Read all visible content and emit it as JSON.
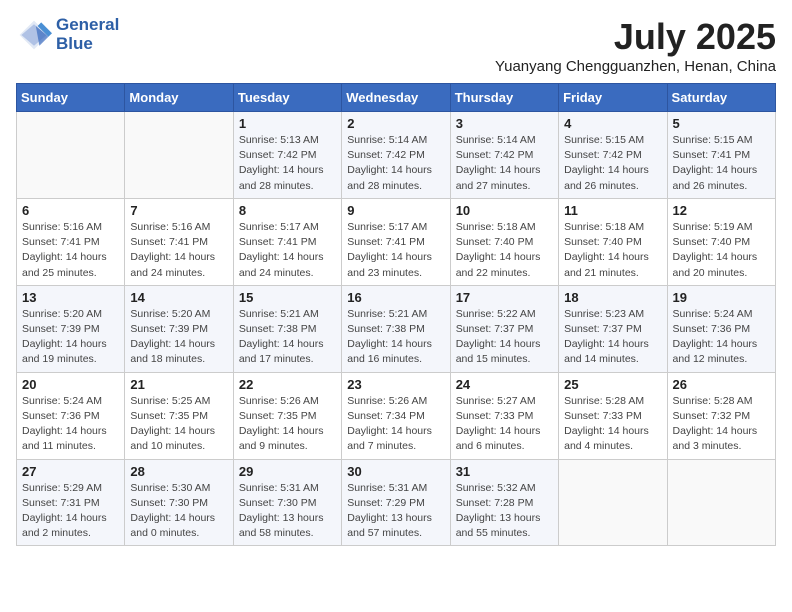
{
  "header": {
    "logo_line1": "General",
    "logo_line2": "Blue",
    "month_year": "July 2025",
    "location": "Yuanyang Chengguanzhen, Henan, China"
  },
  "weekdays": [
    "Sunday",
    "Monday",
    "Tuesday",
    "Wednesday",
    "Thursday",
    "Friday",
    "Saturday"
  ],
  "weeks": [
    [
      {
        "day": "",
        "info": ""
      },
      {
        "day": "",
        "info": ""
      },
      {
        "day": "1",
        "info": "Sunrise: 5:13 AM\nSunset: 7:42 PM\nDaylight: 14 hours\nand 28 minutes."
      },
      {
        "day": "2",
        "info": "Sunrise: 5:14 AM\nSunset: 7:42 PM\nDaylight: 14 hours\nand 28 minutes."
      },
      {
        "day": "3",
        "info": "Sunrise: 5:14 AM\nSunset: 7:42 PM\nDaylight: 14 hours\nand 27 minutes."
      },
      {
        "day": "4",
        "info": "Sunrise: 5:15 AM\nSunset: 7:42 PM\nDaylight: 14 hours\nand 26 minutes."
      },
      {
        "day": "5",
        "info": "Sunrise: 5:15 AM\nSunset: 7:41 PM\nDaylight: 14 hours\nand 26 minutes."
      }
    ],
    [
      {
        "day": "6",
        "info": "Sunrise: 5:16 AM\nSunset: 7:41 PM\nDaylight: 14 hours\nand 25 minutes."
      },
      {
        "day": "7",
        "info": "Sunrise: 5:16 AM\nSunset: 7:41 PM\nDaylight: 14 hours\nand 24 minutes."
      },
      {
        "day": "8",
        "info": "Sunrise: 5:17 AM\nSunset: 7:41 PM\nDaylight: 14 hours\nand 24 minutes."
      },
      {
        "day": "9",
        "info": "Sunrise: 5:17 AM\nSunset: 7:41 PM\nDaylight: 14 hours\nand 23 minutes."
      },
      {
        "day": "10",
        "info": "Sunrise: 5:18 AM\nSunset: 7:40 PM\nDaylight: 14 hours\nand 22 minutes."
      },
      {
        "day": "11",
        "info": "Sunrise: 5:18 AM\nSunset: 7:40 PM\nDaylight: 14 hours\nand 21 minutes."
      },
      {
        "day": "12",
        "info": "Sunrise: 5:19 AM\nSunset: 7:40 PM\nDaylight: 14 hours\nand 20 minutes."
      }
    ],
    [
      {
        "day": "13",
        "info": "Sunrise: 5:20 AM\nSunset: 7:39 PM\nDaylight: 14 hours\nand 19 minutes."
      },
      {
        "day": "14",
        "info": "Sunrise: 5:20 AM\nSunset: 7:39 PM\nDaylight: 14 hours\nand 18 minutes."
      },
      {
        "day": "15",
        "info": "Sunrise: 5:21 AM\nSunset: 7:38 PM\nDaylight: 14 hours\nand 17 minutes."
      },
      {
        "day": "16",
        "info": "Sunrise: 5:21 AM\nSunset: 7:38 PM\nDaylight: 14 hours\nand 16 minutes."
      },
      {
        "day": "17",
        "info": "Sunrise: 5:22 AM\nSunset: 7:37 PM\nDaylight: 14 hours\nand 15 minutes."
      },
      {
        "day": "18",
        "info": "Sunrise: 5:23 AM\nSunset: 7:37 PM\nDaylight: 14 hours\nand 14 minutes."
      },
      {
        "day": "19",
        "info": "Sunrise: 5:24 AM\nSunset: 7:36 PM\nDaylight: 14 hours\nand 12 minutes."
      }
    ],
    [
      {
        "day": "20",
        "info": "Sunrise: 5:24 AM\nSunset: 7:36 PM\nDaylight: 14 hours\nand 11 minutes."
      },
      {
        "day": "21",
        "info": "Sunrise: 5:25 AM\nSunset: 7:35 PM\nDaylight: 14 hours\nand 10 minutes."
      },
      {
        "day": "22",
        "info": "Sunrise: 5:26 AM\nSunset: 7:35 PM\nDaylight: 14 hours\nand 9 minutes."
      },
      {
        "day": "23",
        "info": "Sunrise: 5:26 AM\nSunset: 7:34 PM\nDaylight: 14 hours\nand 7 minutes."
      },
      {
        "day": "24",
        "info": "Sunrise: 5:27 AM\nSunset: 7:33 PM\nDaylight: 14 hours\nand 6 minutes."
      },
      {
        "day": "25",
        "info": "Sunrise: 5:28 AM\nSunset: 7:33 PM\nDaylight: 14 hours\nand 4 minutes."
      },
      {
        "day": "26",
        "info": "Sunrise: 5:28 AM\nSunset: 7:32 PM\nDaylight: 14 hours\nand 3 minutes."
      }
    ],
    [
      {
        "day": "27",
        "info": "Sunrise: 5:29 AM\nSunset: 7:31 PM\nDaylight: 14 hours\nand 2 minutes."
      },
      {
        "day": "28",
        "info": "Sunrise: 5:30 AM\nSunset: 7:30 PM\nDaylight: 14 hours\nand 0 minutes."
      },
      {
        "day": "29",
        "info": "Sunrise: 5:31 AM\nSunset: 7:30 PM\nDaylight: 13 hours\nand 58 minutes."
      },
      {
        "day": "30",
        "info": "Sunrise: 5:31 AM\nSunset: 7:29 PM\nDaylight: 13 hours\nand 57 minutes."
      },
      {
        "day": "31",
        "info": "Sunrise: 5:32 AM\nSunset: 7:28 PM\nDaylight: 13 hours\nand 55 minutes."
      },
      {
        "day": "",
        "info": ""
      },
      {
        "day": "",
        "info": ""
      }
    ]
  ]
}
